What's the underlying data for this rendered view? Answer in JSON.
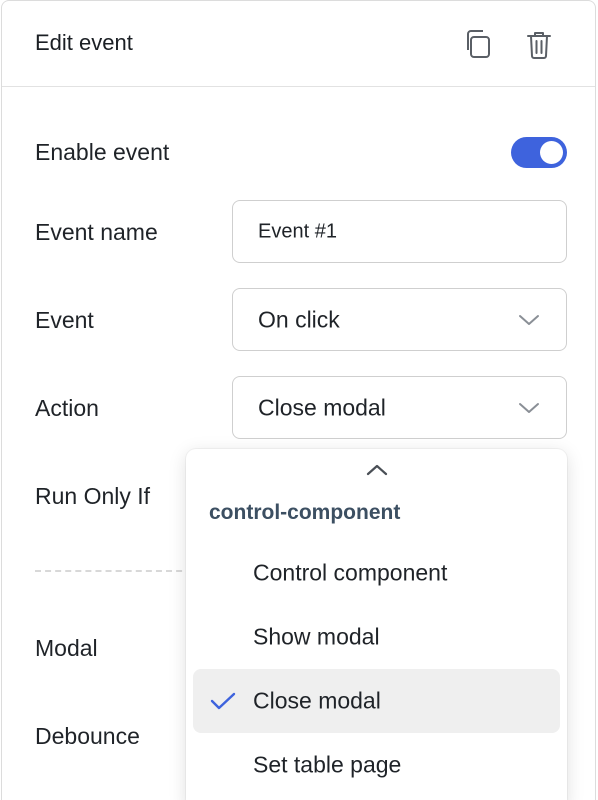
{
  "header": {
    "title": "Edit event",
    "icons": [
      "copy-icon",
      "trash-icon"
    ]
  },
  "form": {
    "enable_event_label": "Enable event",
    "enable_event_value": true,
    "event_name_label": "Event name",
    "event_name_value": "Event #1",
    "event_label": "Event",
    "event_value": "On click",
    "action_label": "Action",
    "action_value": "Close modal",
    "run_only_if_label": "Run Only If",
    "modal_label": "Modal",
    "debounce_label": "Debounce"
  },
  "dropdown": {
    "group_label": "control-component",
    "options": [
      {
        "label": "Control component",
        "selected": false
      },
      {
        "label": "Show modal",
        "selected": false
      },
      {
        "label": "Close modal",
        "selected": true
      },
      {
        "label": "Set table page",
        "selected": false
      }
    ]
  },
  "colors": {
    "accent": "#3e63dd",
    "selected_bg": "#efefef",
    "group_label": "#3c4f62"
  }
}
